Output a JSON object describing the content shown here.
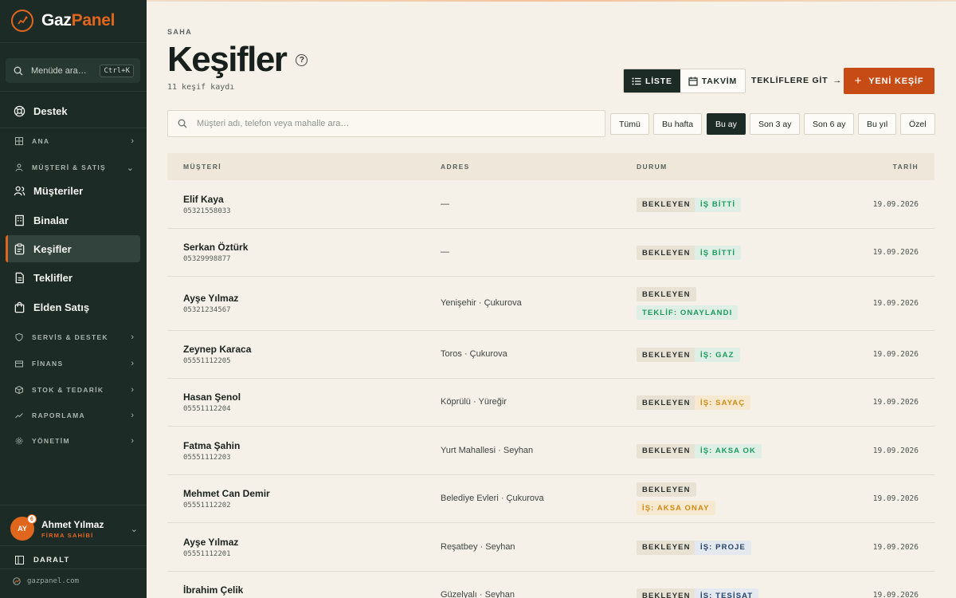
{
  "app": {
    "brand_part1": "Gaz",
    "brand_part2": "Panel"
  },
  "sidebar": {
    "search_placeholder": "Menüde ara…",
    "search_shortcut": "Ctrl+K",
    "support": "Destek",
    "groups": {
      "ana": "ANA",
      "musteri_satis": "MÜŞTERİ & SATIŞ",
      "servis": "SERVİS & DESTEK",
      "finans": "FİNANS",
      "stok": "STOK & TEDARİK",
      "raporlama": "RAPORLAMA",
      "yonetim": "YÖNETİM"
    },
    "items": {
      "musteriler": "Müşteriler",
      "binalar": "Binalar",
      "kesifler": "Keşifler",
      "teklifler": "Teklifler",
      "elden_satis": "Elden Satış"
    },
    "user": {
      "initials": "AY",
      "notif_count": "6",
      "name": "Ahmet Yılmaz",
      "role": "FİRMA SAHİBİ"
    },
    "collapse": "DARALT",
    "site": "gazpanel.com"
  },
  "page": {
    "breadcrumb": "SAHA",
    "title": "Keşifler",
    "count_text": "11 keşif kaydı",
    "view_list": "LİSTE",
    "view_calendar": "TAKVİM",
    "goto_offers": "TEKLİFLERE GİT",
    "new_button": "YENİ KEŞİF",
    "search_placeholder": "Müşteri adı, telefon veya mahalle ara…",
    "filters": [
      "Tümü",
      "Bu hafta",
      "Bu ay",
      "Son 3 ay",
      "Son 6 ay",
      "Bu yıl",
      "Özel"
    ],
    "active_filter": "Bu ay"
  },
  "table": {
    "columns": {
      "customer": "MÜŞTERİ",
      "address": "ADRES",
      "status": "DURUM",
      "date": "TARİH"
    },
    "rows": [
      {
        "name": "Elif Kaya",
        "phone": "05321558033",
        "address": "—",
        "status": "BEKLEYEN",
        "tag": "İŞ BİTTİ",
        "tag_kind": "done",
        "date": "19.09.2026"
      },
      {
        "name": "Serkan Öztürk",
        "phone": "05329998877",
        "address": "—",
        "status": "BEKLEYEN",
        "tag": "İŞ BİTTİ",
        "tag_kind": "done",
        "date": "19.09.2026"
      },
      {
        "name": "Ayşe Yılmaz",
        "phone": "05321234567",
        "address": "Yenişehir · Çukurova",
        "status": "BEKLEYEN",
        "tag": "TEKLİF: ONAYLANDI",
        "tag_kind": "done",
        "date": "19.09.2026"
      },
      {
        "name": "Zeynep Karaca",
        "phone": "05551112205",
        "address": "Toros · Çukurova",
        "status": "BEKLEYEN",
        "tag": "İŞ: GAZ",
        "tag_kind": "gaz",
        "date": "19.09.2026"
      },
      {
        "name": "Hasan Şenol",
        "phone": "05551112204",
        "address": "Köprülü · Yüreğir",
        "status": "BEKLEYEN",
        "tag": "İŞ: SAYAÇ",
        "tag_kind": "warn",
        "date": "19.09.2026"
      },
      {
        "name": "Fatma Şahin",
        "phone": "05551112203",
        "address": "Yurt Mahallesi · Seyhan",
        "status": "BEKLEYEN",
        "tag": "İŞ: AKSA OK",
        "tag_kind": "done",
        "date": "19.09.2026"
      },
      {
        "name": "Mehmet Can Demir",
        "phone": "05551112202",
        "address": "Belediye Evleri · Çukurova",
        "status": "BEKLEYEN",
        "tag": "İŞ: AKSA ONAY",
        "tag_kind": "warn",
        "date": "19.09.2026"
      },
      {
        "name": "Ayşe Yılmaz",
        "phone": "05551112201",
        "address": "Reşatbey · Seyhan",
        "status": "BEKLEYEN",
        "tag": "İŞ: PROJE",
        "tag_kind": "proje",
        "date": "19.09.2026"
      },
      {
        "name": "İbrahim Çelik",
        "phone": "",
        "address": "Güzelyalı · Seyhan",
        "status": "BEKLEYEN",
        "tag": "İŞ: TESİSAT",
        "tag_kind": "proje",
        "date": "19.09.2026"
      }
    ]
  },
  "colors": {
    "sidebar_bg": "#1d2b26",
    "accent": "#e0661d",
    "primary_button": "#c74b14",
    "page_bg": "#f6f1e8"
  }
}
